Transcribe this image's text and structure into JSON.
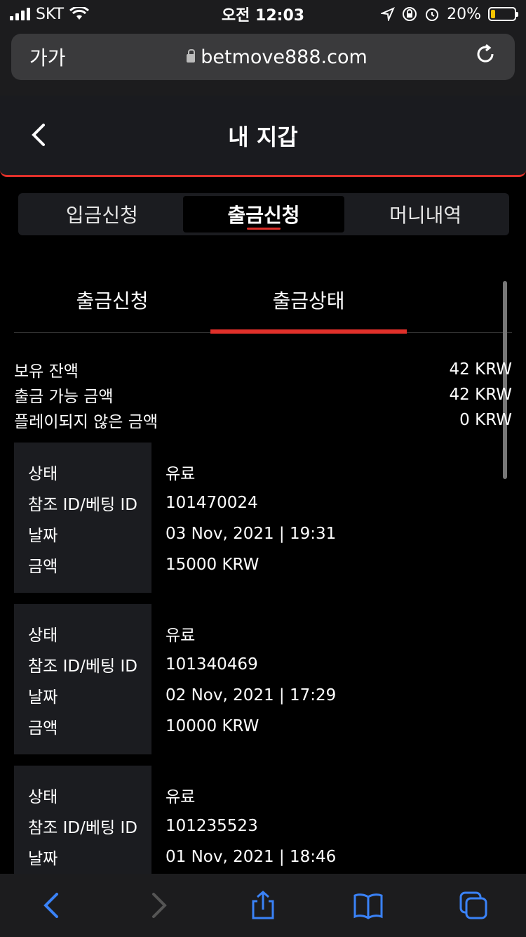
{
  "status": {
    "carrier": "SKT",
    "time": "오전 12:03",
    "battery": "20%",
    "battery_level": 0.2,
    "battery_color": "#f5c400"
  },
  "browser": {
    "aa_label": "가가",
    "url": "betmove888.com"
  },
  "header": {
    "title": "내 지갑"
  },
  "main_tabs": [
    {
      "label": "입금신청",
      "active": false
    },
    {
      "label": "출금신청",
      "active": true
    },
    {
      "label": "머니내역",
      "active": false
    }
  ],
  "sub_tabs": [
    {
      "label": "출금신청",
      "active": false
    },
    {
      "label": "출금상태",
      "active": true
    }
  ],
  "summary": [
    {
      "label": "보유 잔액",
      "value": "42 KRW"
    },
    {
      "label": "출금 가능 금액",
      "value": "42 KRW"
    },
    {
      "label": "플레이되지 않은 금액",
      "value": "0 KRW"
    }
  ],
  "card_labels": {
    "status": "상태",
    "ref": "참조 ID/베팅 ID",
    "date": "날짜",
    "amount": "금액"
  },
  "transactions": [
    {
      "status": "유료",
      "ref": "101470024",
      "date": "03 Nov, 2021 | 19:31",
      "amount": "15000 KRW"
    },
    {
      "status": "유료",
      "ref": "101340469",
      "date": "02 Nov, 2021 | 17:29",
      "amount": "10000 KRW"
    },
    {
      "status": "유료",
      "ref": "101235523",
      "date": "01 Nov, 2021 | 18:46"
    }
  ],
  "colors": {
    "accent": "#e0302a",
    "toolbar_icon": "#3a82f7"
  }
}
